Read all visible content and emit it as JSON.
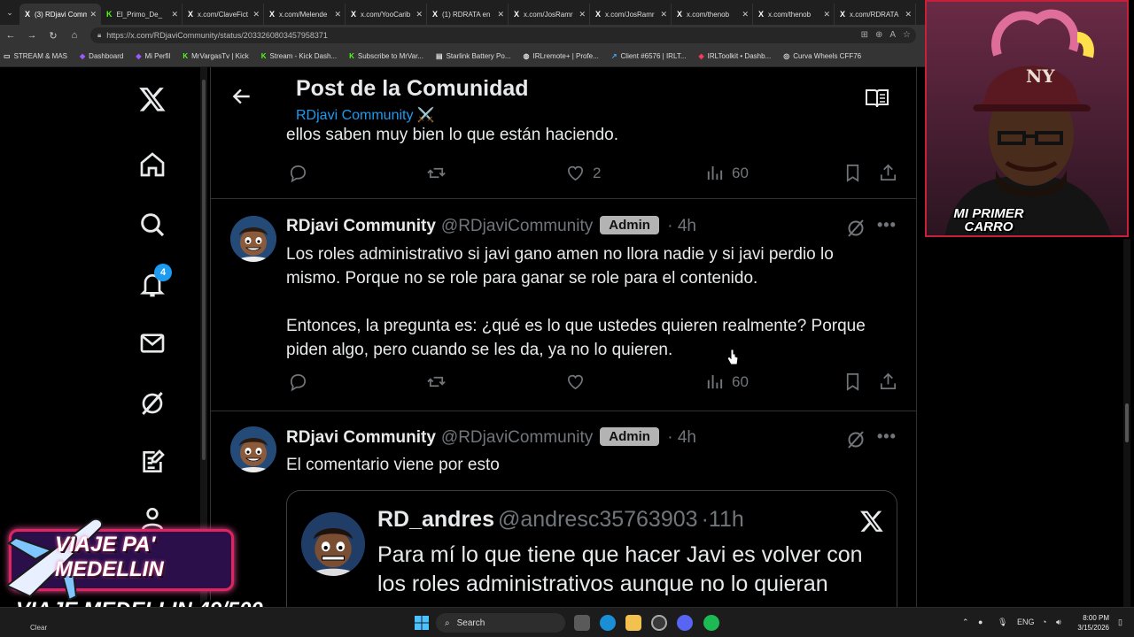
{
  "browser": {
    "tabs": [
      {
        "favicon": "X",
        "title": "(3) RDjavi Comm",
        "active": true
      },
      {
        "favicon": "K",
        "title": "El_Primo_De_"
      },
      {
        "favicon": "X",
        "title": "x.com/ClaveFict"
      },
      {
        "favicon": "X",
        "title": "x.com/Melende"
      },
      {
        "favicon": "X",
        "title": "x.com/YooCarib"
      },
      {
        "favicon": "X",
        "title": "(1) RDRATA en"
      },
      {
        "favicon": "X",
        "title": "x.com/JosRamr"
      },
      {
        "favicon": "X",
        "title": "x.com/JosRamr"
      },
      {
        "favicon": "X",
        "title": "x.com/thenob"
      },
      {
        "favicon": "X",
        "title": "x.com/thenob"
      },
      {
        "favicon": "X",
        "title": "x.com/RDRATA"
      }
    ],
    "url": "https://x.com/RDjaviCommunity/status/2033260803457958371",
    "bookmarks": [
      {
        "icon": "folder",
        "label": "STREAM & MAS"
      },
      {
        "icon": "dashboard",
        "label": "Dashboard"
      },
      {
        "icon": "dashboard",
        "label": "Mi Perfil"
      },
      {
        "icon": "K",
        "label": "MrVargasTv | Kick"
      },
      {
        "icon": "K",
        "label": "Stream - Kick Dash..."
      },
      {
        "icon": "K",
        "label": "Subscribe to MrVar..."
      },
      {
        "icon": "page",
        "label": "Starlink Battery Po..."
      },
      {
        "icon": "globe",
        "label": "IRLremote+ | Profe..."
      },
      {
        "icon": "link",
        "label": "Client #6576 | IRLT..."
      },
      {
        "icon": "irl",
        "label": "IRLToolkit • Dashb..."
      },
      {
        "icon": "wheel",
        "label": "Curva Wheels CFF76"
      }
    ]
  },
  "nav": {
    "notifications_count": "4"
  },
  "header": {
    "title": "Post de la Comunidad",
    "community": "RDjavi Community ⚔️"
  },
  "previous_post": {
    "text_tail": "ellos saben muy bien lo que están haciendo.",
    "likes": "2",
    "views": "60"
  },
  "posts": [
    {
      "name": "RDjavi Community",
      "handle": "@RDjaviCommunity",
      "badge": "Admin",
      "time": "4h",
      "paragraph1": "Los roles administrativo si javi gano amen no llora nadie y si javi perdio lo mismo. Porque no se role para ganar se role para el contenido.",
      "paragraph2": "Entonces, la pregunta es: ¿qué es lo que ustedes quieren realmente? Porque piden algo, pero cuando se les da, ya no lo quieren.",
      "views": "60"
    },
    {
      "name": "RDjavi Community",
      "handle": "@RDjaviCommunity",
      "badge": "Admin",
      "time": "4h",
      "text": "El comentario viene por esto",
      "quote": {
        "name": "RD_andres",
        "handle": "@andresc35763903",
        "time": "11h",
        "text": "Para mí lo que tiene que hacer Javi es volver con los roles administrativos aunque no lo quieran"
      }
    }
  ],
  "overlays": {
    "cam_label": "MI PRIMER CARRO",
    "cap_logo": "NY",
    "trip_title": "VIAJE PA' MEDELLIN",
    "trip_counter": "VIAJE MEDELLIN 49/500"
  },
  "taskbar": {
    "weather": "Clear",
    "search": "Search",
    "language": "ENG",
    "time": "8:00 PM",
    "date": "3/15/2026"
  },
  "colors": {
    "x_blue": "#1d9bf0",
    "muted": "#71767b",
    "admin_badge": "#b3b3b3",
    "overlay_pink": "#e0245e"
  }
}
